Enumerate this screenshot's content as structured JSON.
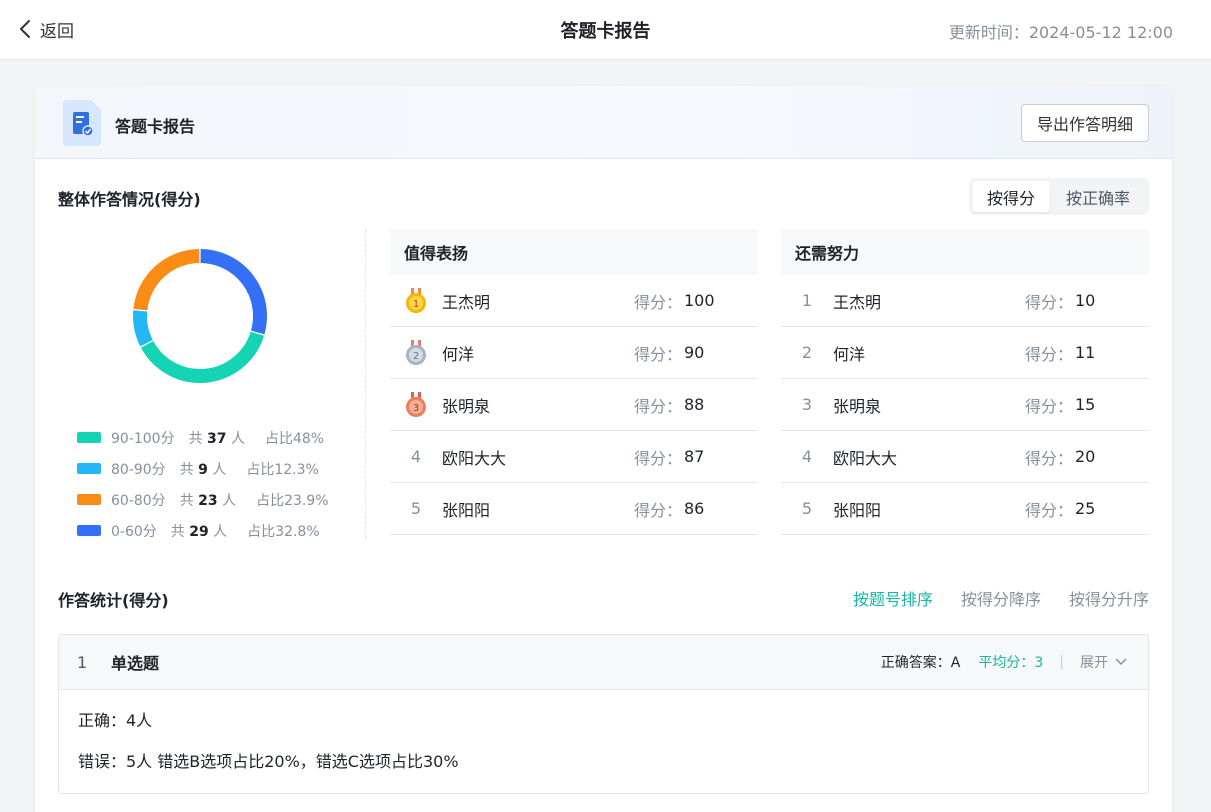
{
  "topbar": {
    "back_label": "返回",
    "title": "答题卡报告",
    "update_time": "更新时间：2024-05-12 12:00"
  },
  "card": {
    "title": "答题卡报告",
    "export_label": "导出作答明细"
  },
  "overview": {
    "title": "整体作答情况(得分)",
    "toggle": [
      "按得分",
      "按正确率"
    ],
    "toggle_active": 0
  },
  "chart_data": {
    "type": "pie",
    "categories": [
      "90-100分",
      "80-90分",
      "60-80分",
      "0-60分"
    ],
    "counts": [
      37,
      9,
      23,
      29
    ],
    "values": [
      48,
      12.3,
      23.9,
      32.8
    ],
    "colors": [
      "#14d4b4",
      "#23b8f5",
      "#fa8c16",
      "#3470f6"
    ]
  },
  "legend": [
    {
      "range": "90-100分",
      "count_prefix": "共",
      "count": "37",
      "count_suffix": "人",
      "ratio": "占比48%"
    },
    {
      "range": "80-90分",
      "count_prefix": "共",
      "count": "9",
      "count_suffix": "人",
      "ratio": "占比12.3%"
    },
    {
      "range": "60-80分",
      "count_prefix": "共",
      "count": "23",
      "count_suffix": "人",
      "ratio": "占比23.9%"
    },
    {
      "range": "0-60分",
      "count_prefix": "共",
      "count": "29",
      "count_suffix": "人",
      "ratio": "占比32.8%"
    }
  ],
  "praise": {
    "title": "值得表扬",
    "score_label": "得分：",
    "rows": [
      {
        "rank": "1",
        "name": "王杰明",
        "score": "100"
      },
      {
        "rank": "2",
        "name": "何洋",
        "score": "90"
      },
      {
        "rank": "3",
        "name": "张明泉",
        "score": "88"
      },
      {
        "rank": "4",
        "name": "欧阳大大",
        "score": "87"
      },
      {
        "rank": "5",
        "name": "张阳阳",
        "score": "86"
      }
    ]
  },
  "improve": {
    "title": "还需努力",
    "score_label": "得分：",
    "rows": [
      {
        "rank": "1",
        "name": "王杰明",
        "score": "10"
      },
      {
        "rank": "2",
        "name": "何洋",
        "score": "11"
      },
      {
        "rank": "3",
        "name": "张明泉",
        "score": "15"
      },
      {
        "rank": "4",
        "name": "欧阳大大",
        "score": "20"
      },
      {
        "rank": "5",
        "name": "张阳阳",
        "score": "25"
      }
    ]
  },
  "stats": {
    "title": "作答统计(得分)",
    "sort_tabs": [
      "按题号排序",
      "按得分降序",
      "按得分升序"
    ],
    "sort_active": 0
  },
  "question": {
    "number": "1",
    "type": "单选题",
    "answer": "正确答案：A",
    "average": "平均分：3",
    "separator": "|",
    "expand_label": "展开",
    "correct": "正确：4人",
    "wrong": "错误：5人  错选B选项占比20%，错选C选项占比30%"
  },
  "colors": {
    "accent": "#14b8a6",
    "gold": "#f5b800",
    "silver": "#a9b4c2",
    "bronze": "#e9805a"
  }
}
